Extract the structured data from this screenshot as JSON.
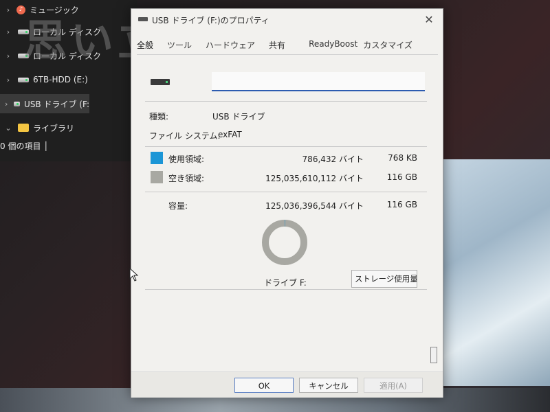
{
  "overlay": {
    "caption": "思い立ったら寿る！"
  },
  "explorer": {
    "items": [
      {
        "chevron": "›",
        "label": "ミュージック",
        "icon": "music-icon"
      },
      {
        "chevron": "›",
        "label": "ローカル ディスク",
        "icon": "drive-icon"
      },
      {
        "chevron": "›",
        "label": "ローカル ディスク",
        "icon": "drive-icon"
      },
      {
        "chevron": "›",
        "label": "6TB-HDD (E:)",
        "icon": "drive-icon"
      },
      {
        "chevron": "›",
        "label": "USB ドライブ (F:",
        "icon": "usb-drive-icon"
      },
      {
        "chevron": "⌄",
        "label": "ライブラリ",
        "icon": "folder-icon"
      }
    ],
    "status": "0 個の項目 │"
  },
  "dialog": {
    "title": "USB ドライブ (F:)のプロパティ",
    "close": "✕",
    "tabs": [
      "全般",
      "ツール",
      "ハードウェア",
      "共有",
      "ReadyBoost",
      "カスタマイズ"
    ],
    "active_tab": "全般",
    "name_value": "",
    "type_label": "種類:",
    "type_value": "USB ドライブ",
    "fs_label": "ファイル システム:",
    "fs_value": "exFAT",
    "used": {
      "label": "使用領域:",
      "bytes": "786,432 バイト",
      "size": "768 KB",
      "color": "#1c96d6"
    },
    "free": {
      "label": "空き領域:",
      "bytes": "125,035,610,112 バイト",
      "size": "116 GB",
      "color": "#a8a8a2"
    },
    "capacity": {
      "label": "容量:",
      "bytes": "125,036,396,544 バイト",
      "size": "116 GB"
    },
    "drive_caption": "ドライブ F:",
    "storage_button": "ストレージ使用量(S)",
    "buttons": {
      "ok": "OK",
      "cancel": "キャンセル",
      "apply": "適用(A)"
    }
  }
}
